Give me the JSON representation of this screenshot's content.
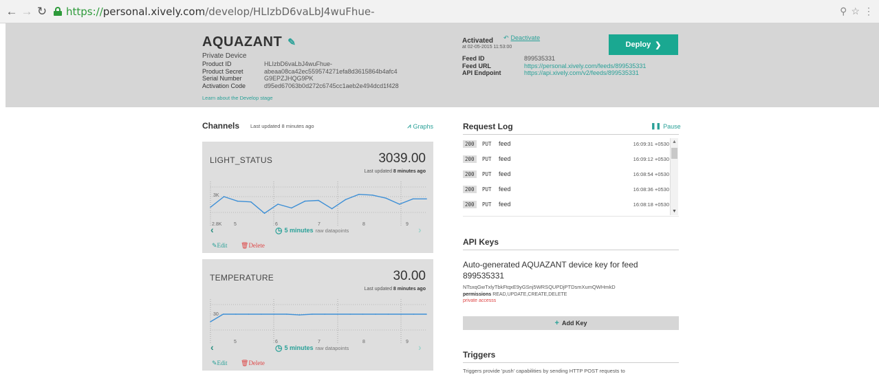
{
  "browser": {
    "url_secure": "https://",
    "url_host": "personal.xively.com",
    "url_path": "/develop/HLIzbD6vaLbJ4wuFhue-"
  },
  "device": {
    "name": "AQUAZANT",
    "subtitle": "Private Device",
    "info": [
      {
        "label": "Product ID",
        "value": "HLIzbD6vaLbJ4wuFhue-"
      },
      {
        "label": "Product Secret",
        "value": "abeaa08ca42ec559574271efa8d3615864b4afc4"
      },
      {
        "label": "Serial Number",
        "value": "G9EPZJHQG9PK"
      },
      {
        "label": "Activation Code",
        "value": "d95ed67063b0d272c6745cc1aeb2e494dcd1f428"
      }
    ],
    "learn_link": "Learn about the Develop stage",
    "activated_label": "Activated",
    "deactivate_label": "Deactivate",
    "activated_date": "at 02-05-2015 11:53:00",
    "feed": [
      {
        "label": "Feed ID",
        "value": "899535331",
        "link": false
      },
      {
        "label": "Feed URL",
        "value": "https://personal.xively.com/feeds/899535331",
        "link": true
      },
      {
        "label": "API Endpoint",
        "value": "https://api.xively.com/v2/feeds/899535331",
        "link": true
      }
    ],
    "deploy_label": "Deploy"
  },
  "channels": {
    "title": "Channels",
    "updated": "Last updated 8 minutes ago",
    "graphs_label": "Graphs",
    "edit_label": "Edit",
    "delete_label": "Delete",
    "time_label": "5 minutes",
    "raw_label": "raw datapoints",
    "items": [
      {
        "name": "LIGHT_STATUS",
        "value": "3039.00",
        "last_prefix": "Last updated",
        "last_bold": "8 minutes ago",
        "y_ticks": [
          "3K",
          "2.8K"
        ],
        "x_ticks": [
          "5",
          "6",
          "7",
          "8",
          "9"
        ],
        "chart_data": {
          "type": "line",
          "ylim": [
            2790,
            3090
          ],
          "values": [
            2920,
            2990,
            2960,
            2955,
            2880,
            2940,
            2915,
            2960,
            2965,
            2910,
            2970,
            3005,
            3000,
            2980,
            2940,
            2975,
            2975
          ]
        }
      },
      {
        "name": "TEMPERATURE",
        "value": "30.00",
        "last_prefix": "Last updated",
        "last_bold": "8 minutes ago",
        "y_ticks": [
          "30"
        ],
        "x_ticks": [
          "5",
          "6",
          "7",
          "8",
          "9"
        ],
        "chart_data": {
          "type": "line",
          "ylim": [
            26,
            32
          ],
          "values": [
            29,
            30,
            30,
            30,
            30,
            30,
            30,
            29.9,
            30,
            30,
            30,
            30,
            30,
            30,
            30,
            30,
            30,
            30
          ]
        }
      }
    ]
  },
  "request_log": {
    "title": "Request Log",
    "pause_label": "Pause",
    "rows": [
      {
        "code": "200",
        "method": "PUT",
        "path": "feed",
        "time": "16:09:31 +0530"
      },
      {
        "code": "200",
        "method": "PUT",
        "path": "feed",
        "time": "16:09:12 +0530"
      },
      {
        "code": "200",
        "method": "PUT",
        "path": "feed",
        "time": "16:08:54 +0530"
      },
      {
        "code": "200",
        "method": "PUT",
        "path": "feed",
        "time": "16:08:36 +0530"
      },
      {
        "code": "200",
        "method": "PUT",
        "path": "feed",
        "time": "16:08:18 +0530"
      }
    ]
  },
  "api_keys": {
    "title": "API Keys",
    "name": "Auto-generated AQUAZANT device key for feed 899535331",
    "key": "NTsxqGwTxlyTbkFtqxE9yGSnj5WRSQUPDjPTDsmXumQWHmkD",
    "permissions_label": "permissions",
    "permissions_value": "READ,UPDATE,CREATE,DELETE",
    "private_label": "private accesss",
    "add_key_label": "Add Key"
  },
  "triggers": {
    "title": "Triggers",
    "text": "Triggers provide 'push' capabilities by sending HTTP POST requests to"
  }
}
